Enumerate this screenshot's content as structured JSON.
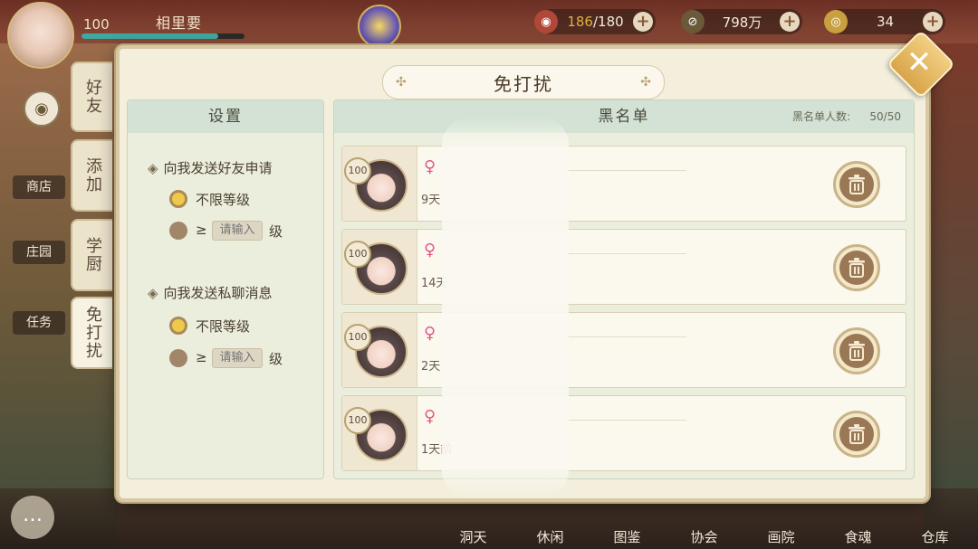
{
  "hud": {
    "player_level": "100",
    "player_name": "相里要",
    "stamina": "186",
    "stamina_max": "/180",
    "coins": "798万",
    "gems": "34",
    "hp_fraction": 0.84
  },
  "side_hud": {
    "shop": "商店",
    "garden": "庄园",
    "task": "任务"
  },
  "bottom_nav": [
    "洞天",
    "休闲",
    "图鉴",
    "协会",
    "画院",
    "食魂",
    "仓库"
  ],
  "modal": {
    "title": "免打扰",
    "tabs": [
      {
        "label": "好友"
      },
      {
        "label": "添加"
      },
      {
        "label": "学厨"
      },
      {
        "label": "免打扰",
        "active": true
      }
    ],
    "settings": {
      "header": "设置",
      "friend_request": {
        "title": "向我发送好友申请",
        "option_any": "不限等级",
        "ge_symbol": "≥",
        "input_placeholder": "请输入",
        "unit": "级"
      },
      "private_chat": {
        "title": "向我发送私聊消息",
        "option_any": "不限等级",
        "ge_symbol": "≥",
        "input_placeholder": "请输入",
        "unit": "级"
      }
    },
    "blacklist": {
      "header": "黑名单",
      "count_label": "黑名单人数:",
      "count_value": "50/50",
      "rows": [
        {
          "level": "100",
          "time": "9天"
        },
        {
          "level": "100",
          "time": "14天"
        },
        {
          "level": "100",
          "time": "2天"
        },
        {
          "level": "100",
          "time": "1天前"
        }
      ]
    }
  }
}
